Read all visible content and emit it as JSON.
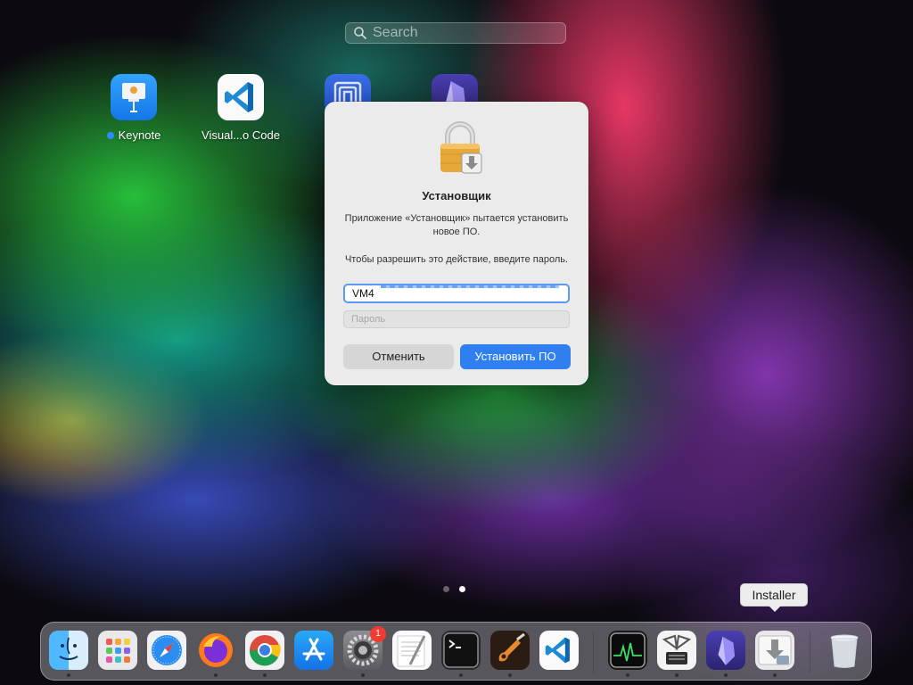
{
  "search": {
    "placeholder": "Search"
  },
  "launchpad": {
    "apps": [
      {
        "name": "Keynote",
        "running": true
      },
      {
        "name": "Visual...o Code",
        "running": false
      },
      {
        "name": "",
        "running": false
      },
      {
        "name": "",
        "running": false
      }
    ],
    "pages": 2,
    "current_page": 2
  },
  "dialog": {
    "title": "Установщик",
    "message": "Приложение «Установщик» пытается установить новое ПО.",
    "prompt": "Чтобы разрешить это действие, введите пароль.",
    "username": "VM4",
    "password_placeholder": "Пароль",
    "cancel_label": "Отменить",
    "confirm_label": "Установить ПО"
  },
  "dock": {
    "tooltip": "Installer",
    "items": [
      {
        "icon": "finder-icon",
        "running": true
      },
      {
        "icon": "launchpad-icon",
        "running": false
      },
      {
        "icon": "safari-icon",
        "running": false
      },
      {
        "icon": "firefox-icon",
        "running": true
      },
      {
        "icon": "chrome-icon",
        "running": true
      },
      {
        "icon": "app-store-icon",
        "running": false
      },
      {
        "icon": "system-preferences-icon",
        "running": true,
        "badge": "1"
      },
      {
        "icon": "textedit-icon",
        "running": false
      },
      {
        "icon": "terminal-icon",
        "running": true
      },
      {
        "icon": "garageband-icon",
        "running": true
      },
      {
        "icon": "vscode-icon",
        "running": false
      },
      {
        "icon": "activity-monitor-icon",
        "running": true
      },
      {
        "icon": "system-information-icon",
        "running": true
      },
      {
        "icon": "obsidian-icon",
        "running": true
      },
      {
        "icon": "installer-icon",
        "running": true
      },
      {
        "icon": "trash-icon",
        "running": false
      }
    ]
  },
  "colors": {
    "accent": "#2f7ff0",
    "focus_ring": "#5b9af4",
    "badge": "#f23b30"
  }
}
